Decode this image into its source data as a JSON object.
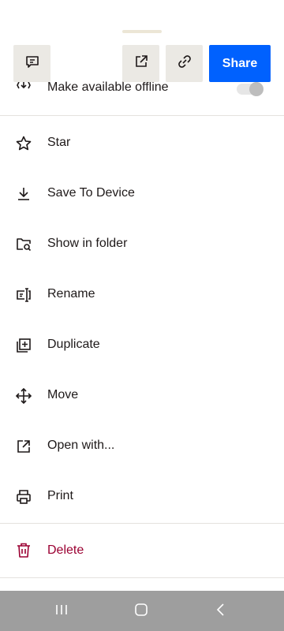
{
  "partial_row": {
    "label": "Make available offline",
    "icon": "offline-icon"
  },
  "toolbar": {
    "comment_icon": "comment-icon",
    "open_external_icon": "open-external-icon",
    "link_icon": "link-icon",
    "share_label": "Share"
  },
  "menu": {
    "items": [
      {
        "label": "Star",
        "icon": "star-icon"
      },
      {
        "label": "Save To Device",
        "icon": "download-icon"
      },
      {
        "label": "Show in folder",
        "icon": "folder-search-icon"
      },
      {
        "label": "Rename",
        "icon": "rename-icon"
      },
      {
        "label": "Duplicate",
        "icon": "duplicate-icon"
      },
      {
        "label": "Move",
        "icon": "move-icon"
      },
      {
        "label": "Open with...",
        "icon": "open-with-icon"
      },
      {
        "label": "Print",
        "icon": "print-icon"
      }
    ],
    "delete": {
      "label": "Delete",
      "icon": "trash-icon"
    }
  },
  "colors": {
    "accent": "#0061fe",
    "danger": "#9b0032",
    "button_bg": "#ebe9e4",
    "navbar": "#9e9e9e"
  },
  "system_nav": {
    "recents_icon": "recents-icon",
    "home_icon": "home-icon",
    "back_icon": "back-icon"
  }
}
